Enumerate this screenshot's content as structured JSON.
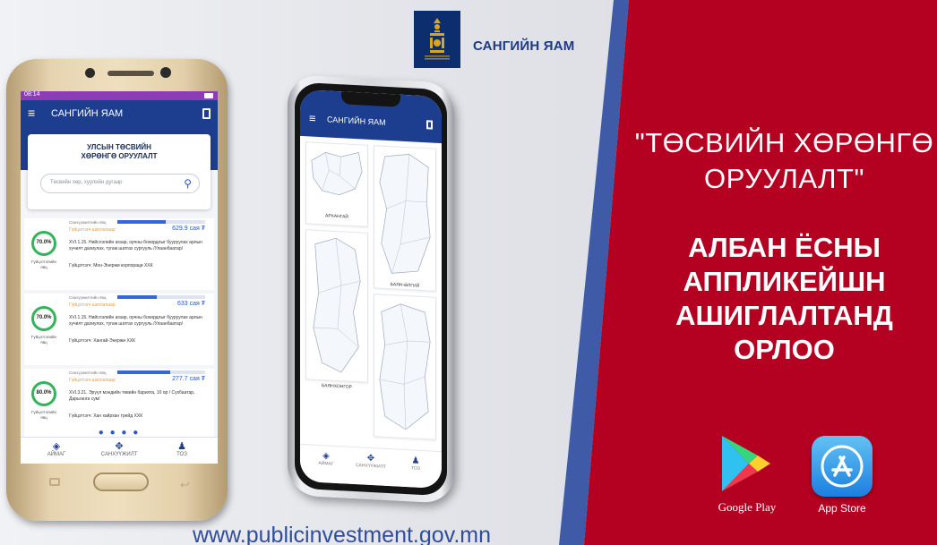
{
  "brand": {
    "ministry_name": "САНГИЙН ЯАМ"
  },
  "website": "www.publicinvestment.gov.mn",
  "headline": {
    "quote_line1": "\"ТӨСВИЙН ХӨРӨНГӨ",
    "quote_line2": "ОРУУЛАЛТ\"",
    "official_line1": "АЛБАН ЁСНЫ",
    "official_line2": "АППЛИКЕЙШН",
    "official_line3": "АШИГЛАЛТАНД",
    "official_line4": "ОРЛОО"
  },
  "stores": {
    "google_play_label": "Google Play",
    "app_store_label": "App Store"
  },
  "colors": {
    "red_panel": "#b40021",
    "blue_stripe": "#3f5aa6",
    "app_blue": "#1d3d8f",
    "progress_green": "#34b35a",
    "amount_blue": "#2b57c4",
    "status_orange": "#f29a2e"
  },
  "android_app": {
    "status_time": "08:14",
    "title": "САНГИЙН ЯАМ",
    "menu_icon": "menu-icon",
    "map_icon": "map-icon",
    "hero_line1": "УЛСЫН ТӨСВИЙН",
    "hero_line2": "ХӨРӨНГӨ ОРУУЛАЛТ",
    "search_placeholder": "Төсвийн хөр, хуулийн дугаар",
    "items": [
      {
        "meta": "Санхүүжилтийн явц",
        "status": "Гүйцэтгэгч шатлалаар",
        "amount": "629.9 сая ₮",
        "progress": "70.0%",
        "progress_value": 0.7,
        "funding_progress": 0.55,
        "progress_label_1": "Гүйцэтгэлийн",
        "progress_label_2": "явц",
        "description": "XVI.1.15. Нийслэлийн агаар, орчны бохирдлыг бууруулах арлын хучилт дахиулах, тугаж шатгах сургууль /Улаанбаатар/",
        "contractor_label": "Гүйцэтгэгч:",
        "contractor": "Мон-Энержи корпораци ХХК"
      },
      {
        "meta": "Санхүүжилтийн явц",
        "status": "Гүйцэтгэгч шатлалаар",
        "amount": "633 сая ₮",
        "progress": "70.0%",
        "progress_value": 0.7,
        "funding_progress": 0.45,
        "progress_label_1": "Гүйцэтгэлийн",
        "progress_label_2": "явц",
        "description": "XVI.1.15. Нийслэлийн агаар, орчны бохирдлыг бууруулах арлын хучилт дахиулах, тугаж шатгах сургууль /Улаанбаатар/",
        "contractor_label": "Гүйцэтгэгч:",
        "contractor": "Хангай-Энержи ХХК"
      },
      {
        "meta": "Санхүүжилтийн явц",
        "status": "Гүйцэтгэгч шатлалаар",
        "amount": "277.7 сая ₮",
        "progress": "80.0%",
        "progress_value": 0.8,
        "funding_progress": 0.6,
        "progress_label_1": "Гүйцэтгэлийн",
        "progress_label_2": "явц",
        "description": "XVI.3.21. Эрүүл мэндийн төвийн барилга, 10 ор / Сүхбаатар, Дарьганга сум/",
        "contractor_label": "Гүйцэтгэгч:",
        "contractor": "Хан хайрхан трейд ХХК"
      }
    ],
    "page_dots": "● ● ● ●",
    "tabs": [
      {
        "label": "АЙМАГ",
        "icon": "layers-icon"
      },
      {
        "label": "САНХҮҮЖИЛТ",
        "icon": "chart-icon"
      },
      {
        "label": "ТОЗ",
        "icon": "user-icon"
      }
    ]
  },
  "iphone_app": {
    "title": "САНГИЙН ЯАМ",
    "menu_icon": "menu-icon",
    "map_icon": "map-icon",
    "provinces": [
      "АРХАНГАЙ",
      "БАЯН-ӨЛГИЙ",
      "БАЯНХОНГОР"
    ],
    "tabs": [
      {
        "label": "АЙМАГ",
        "icon": "layers-icon"
      },
      {
        "label": "САНХҮҮЖИЛТ",
        "icon": "chart-icon"
      },
      {
        "label": "ТОЗ",
        "icon": "user-icon"
      }
    ]
  }
}
